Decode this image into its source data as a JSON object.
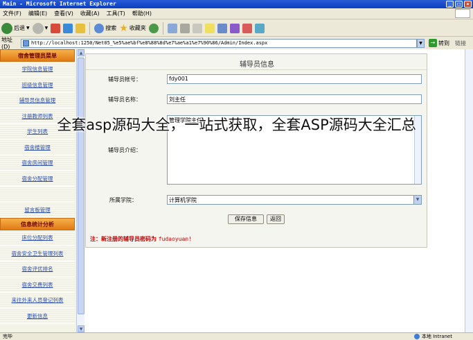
{
  "window": {
    "title": "Main - Microsoft Internet Explorer",
    "minimize": "_",
    "maximize": "□",
    "close": "×"
  },
  "menu": [
    "文件(F)",
    "编辑(E)",
    "查看(V)",
    "收藏(A)",
    "工具(T)",
    "帮助(H)"
  ],
  "toolbar": {
    "back_label": "后退",
    "search_label": "搜索",
    "favorites_label": "收藏夹"
  },
  "address": {
    "label": "地址(D)",
    "url": "http://localhost:1250/Net05_%e5%ae%bf%e8%88%8d%e7%ae%a1%e7%90%86/Admin/Index.aspx",
    "go_label": "转到",
    "links_label": "链接"
  },
  "sidebar": {
    "header1": "宿舍管理员菜单",
    "group1": [
      "学院信息管理",
      "班级信息管理",
      "辅导员信息管理",
      "注册教师列表",
      "学生列表",
      "宿舍楼管理",
      "宿舍房间管理",
      "宿舍分配管理",
      "",
      "留言板管理"
    ],
    "header2": "信息统计分析",
    "group2": [
      "床位分配列表",
      "宿舍安全卫生管理列表",
      "宿舍评优排名",
      "宿舍交费列表",
      "来往外来人员登记列表",
      "更新信息"
    ]
  },
  "form": {
    "title": "辅导员信息",
    "account_label": "辅导员帐号：",
    "account_value": "fdy001",
    "name_label": "辅导员名称：",
    "name_value": "刘主任",
    "intro_label": "辅导员介绍：",
    "intro_value": "管理学院主任",
    "college_label": "所属学院：",
    "college_value": "计算机学院",
    "save_button": "保存信息",
    "back_button": "返回",
    "note_text": "注：新注册的辅导员密码为",
    "note_password": "fudaoyuan!"
  },
  "caption": "全套asp源码大全，一站式获取，全套ASP源码大全汇总",
  "status": {
    "left": "完毕",
    "zone": "本地 Intranet"
  },
  "colors": {
    "title_bar": "#0a3fc0",
    "sidebar_header": "#e07a14",
    "note": "#c00000"
  }
}
